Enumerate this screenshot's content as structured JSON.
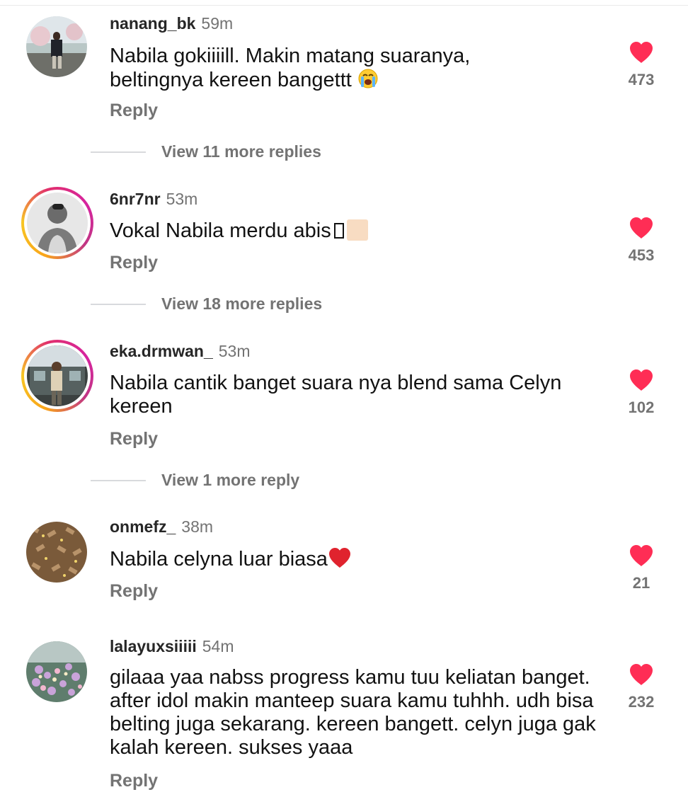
{
  "comments": [
    {
      "username": "nanang_bk",
      "time": "59m",
      "text": "Nabila gokiiiill. Makin matang suaranya, beltingnya kereen bangettt",
      "text_emoji": "loudly-crying-face",
      "reply_label": "Reply",
      "likes": "473",
      "story_ring": false,
      "view_more": "View 11 more replies"
    },
    {
      "username": "6nr7nr",
      "time": "53m",
      "text": "Vokal Nabila merdu abis",
      "text_emoji": "unsupported-glyph-and-skin-tone",
      "reply_label": "Reply",
      "likes": "453",
      "story_ring": true,
      "view_more": "View 18 more replies"
    },
    {
      "username": "eka.drmwan_",
      "time": "53m",
      "text": "Nabila  cantik banget suara nya blend sama Celyn kereen",
      "reply_label": "Reply",
      "likes": "102",
      "story_ring": true,
      "view_more": "View 1 more reply"
    },
    {
      "username": "onmefz_",
      "time": "38m",
      "text": "Nabila celyna luar biasa",
      "text_emoji": "red-heart",
      "reply_label": "Reply",
      "likes": "21",
      "story_ring": false
    },
    {
      "username": "lalayuxsiiiii",
      "time": "54m",
      "text": "gilaaa yaa nabss progress kamu tuu keliatan banget. after idol makin manteep suara kamu tuhhh. udh bisa belting juga sekarang. kereen bangett. celyn juga gak kalah kereen. sukses yaaa",
      "reply_label": "Reply",
      "likes": "232",
      "story_ring": false
    }
  ],
  "colors": {
    "like_heart": "#ff2d55",
    "secondary_text": "#737373",
    "primary_text": "#121212",
    "username": "#262626"
  },
  "icons": {
    "like": "heart-icon",
    "avatar": "avatar-image"
  }
}
